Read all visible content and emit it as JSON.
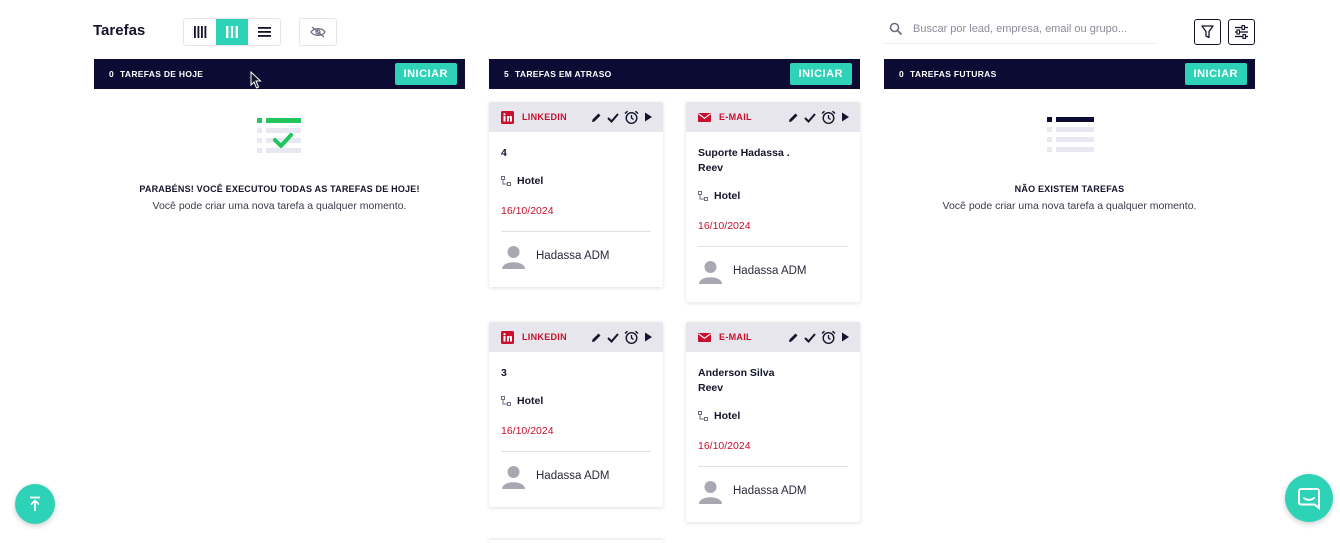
{
  "header": {
    "title": "Tarefas",
    "view_modes": [
      "kanban-compact",
      "kanban",
      "list"
    ],
    "active_view": "kanban",
    "search_placeholder": "Buscar por lead, empresa, email ou grupo..."
  },
  "columns": {
    "today": {
      "count": "0",
      "label": "TAREFAS DE HOJE",
      "start_label": "INICIAR",
      "empty_title": "PARABÉNS! VOCÊ EXECUTOU TODAS AS TAREFAS DE HOJE!",
      "empty_text": "Você pode criar uma nova tarefa a qualquer momento."
    },
    "late": {
      "count": "5",
      "label": "TAREFAS EM ATRASO",
      "start_label": "INICIAR"
    },
    "future": {
      "count": "0",
      "label": "TAREFAS FUTURAS",
      "start_label": "INICIAR",
      "empty_title": "NÃO EXISTEM TAREFAS",
      "empty_text": "Você pode criar uma nova tarefa a qualquer momento."
    }
  },
  "cards": [
    {
      "channel": "LINKEDIN",
      "name": "4",
      "company": "",
      "group": "Hotel",
      "date": "16/10/2024",
      "owner": "Hadassa ADM"
    },
    {
      "channel": "E-MAIL",
      "name": "Suporte Hadassa .",
      "company": "Reev",
      "group": "Hotel",
      "date": "16/10/2024",
      "owner": "Hadassa ADM"
    },
    {
      "channel": "LINKEDIN",
      "name": "3",
      "company": "",
      "group": "Hotel",
      "date": "16/10/2024",
      "owner": "Hadassa ADM"
    },
    {
      "channel": "E-MAIL",
      "name": "Anderson Silva",
      "company": "Reev",
      "group": "Hotel",
      "date": "16/10/2024",
      "owner": "Hadassa ADM"
    }
  ],
  "colors": {
    "accent": "#2ed3b7",
    "header_bg": "#0b0b33",
    "danger": "#c8102e",
    "success": "#22c55e"
  },
  "icons": [
    "view-kanban-compact-icon",
    "view-kanban-icon",
    "view-list-icon",
    "eye-off-icon",
    "search-icon",
    "filter-icon",
    "settings-sliders-icon",
    "linkedin-icon",
    "mail-icon",
    "edit-icon",
    "check-icon",
    "alarm-icon",
    "play-icon",
    "group-icon",
    "avatar-icon",
    "arrow-up-icon",
    "chat-icon"
  ]
}
